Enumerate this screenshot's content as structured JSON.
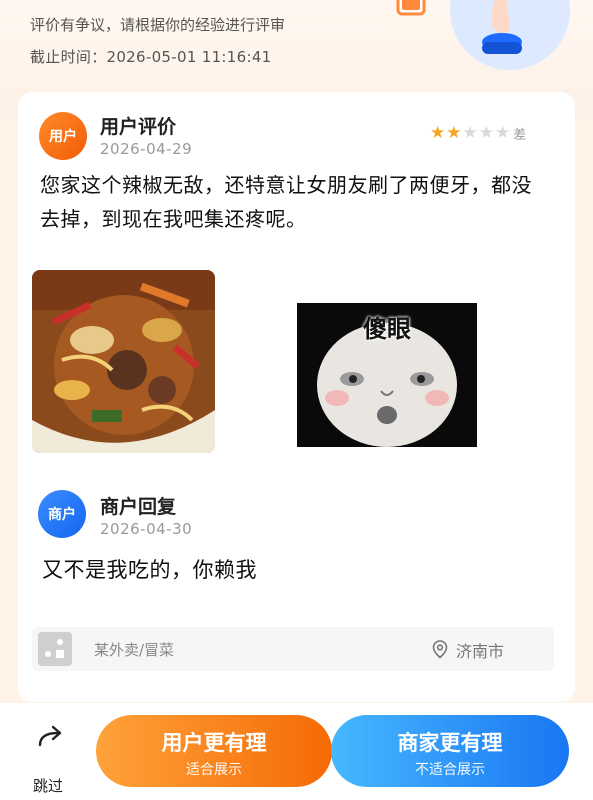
{
  "header": {
    "notice": "评价有争议，请根据你的经验进行评审",
    "deadline": "截止时间：2026-05-01 11:16:41"
  },
  "review": {
    "avatar_label": "用户",
    "author": "用户评价",
    "date": "2026-04-29",
    "rating": 2,
    "rating_max": 5,
    "rating_label": "差",
    "text": "您家这个辣椒无敌，还特意让女朋友刷了两便牙，都没去掉，到现在我吧集还疼呢。",
    "meme_caption": "傻眼"
  },
  "reply": {
    "avatar_label": "商户",
    "author": "商户回复",
    "date": "2026-04-30",
    "text": "又不是我吃的，你赖我"
  },
  "store": {
    "name": "某外卖/冒菜",
    "city": "济南市"
  },
  "actions": {
    "skip_label": "跳过",
    "user_main": "用户更有理",
    "user_sub": "适合展示",
    "merchant_main": "商家更有理",
    "merchant_sub": "不适合展示"
  },
  "colors": {
    "user_accent": "#f56a05",
    "merchant_accent": "#1976f2",
    "star_on": "#f5a623",
    "star_off": "#d9d9d9"
  }
}
